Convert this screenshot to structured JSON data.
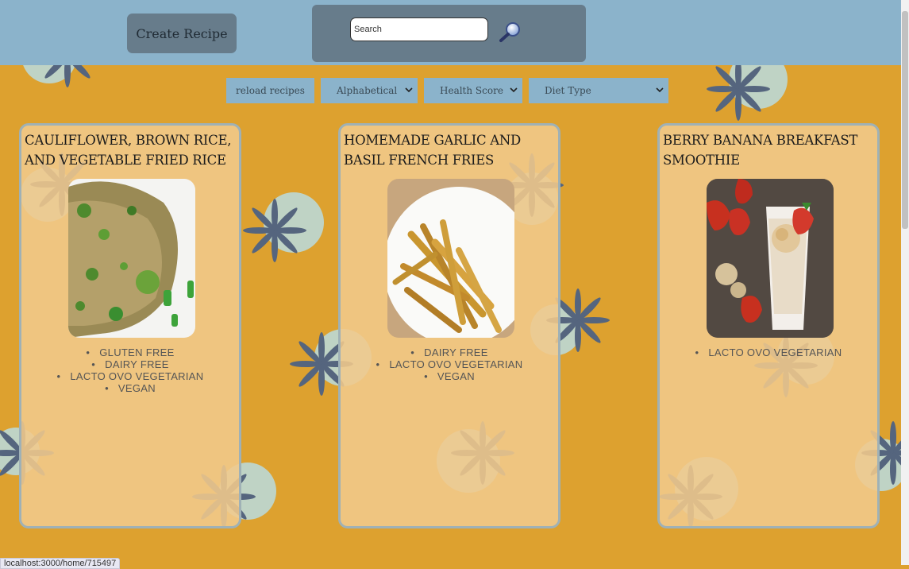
{
  "header": {
    "create_button": "Create Recipe",
    "search_placeholder": "Search"
  },
  "toolbar": {
    "reload_label": "reload recipes",
    "sort_order": "Alphabetical",
    "health_score": "Health Score",
    "diet_type": "Diet Type"
  },
  "recipes": [
    {
      "title": "CAULIFLOWER, BROWN RICE, AND VEGETABLE FRIED RICE",
      "diets": [
        "GLUTEN FREE",
        "DAIRY FREE",
        "LACTO OVO VEGETARIAN",
        "VEGAN"
      ]
    },
    {
      "title": "HOMEMADE GARLIC AND BASIL FRENCH FRIES",
      "diets": [
        "DAIRY FREE",
        "LACTO OVO VEGETARIAN",
        "VEGAN"
      ]
    },
    {
      "title": "BERRY BANANA BREAKFAST SMOOTHIE",
      "diets": [
        "LACTO OVO VEGETARIAN"
      ]
    }
  ],
  "status_bar": {
    "url": "localhost:3000/home/715497"
  },
  "colors": {
    "background": "#DDA12F",
    "header": "#8BB3CB",
    "panel": "#677C8B",
    "card": "#F1C98C",
    "card_border": "#9FB1B6"
  }
}
